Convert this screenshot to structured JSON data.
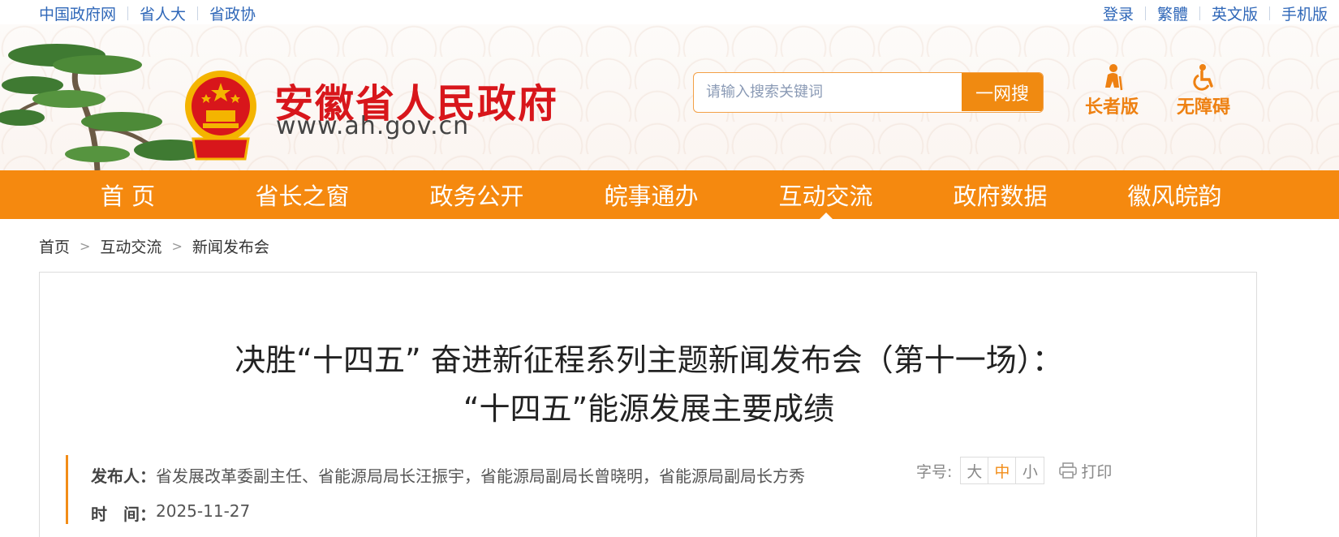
{
  "top_links": {
    "left": [
      "中国政府网",
      "省人大",
      "省政协"
    ],
    "right": [
      "登录",
      "繁體",
      "英文版",
      "手机版"
    ]
  },
  "header": {
    "site_title": "安徽省人民政府",
    "site_url": "www.ah.gov.cn",
    "search_placeholder": "请输入搜索关键词",
    "search_button": "一网搜",
    "elder_label": "长者版",
    "barrier_free_label": "无障碍",
    "accent_color": "#f5890f",
    "title_color": "#d8161b"
  },
  "nav": {
    "items": [
      "首 页",
      "省长之窗",
      "政务公开",
      "皖事通办",
      "互动交流",
      "政府数据",
      "徽风皖韵"
    ],
    "active": "互动交流"
  },
  "breadcrumb": [
    "首页",
    "互动交流",
    "新闻发布会"
  ],
  "article": {
    "title_line1": "决胜“十四五” 奋进新征程系列主题新闻发布会（第十一场）：",
    "title_line2": "“十四五”能源发展主要成绩",
    "publisher_label": "发布人：",
    "publisher": "省发展改革委副主任、省能源局局长汪振宇，省能源局副局长曾晓明，省能源局副局长方秀",
    "time_label": "时　间：",
    "time": "2025-11-27"
  },
  "tools": {
    "font_size_label": "字号:",
    "sizes": [
      "大",
      "中",
      "小"
    ],
    "selected_size": "中",
    "print_label": "打印"
  }
}
